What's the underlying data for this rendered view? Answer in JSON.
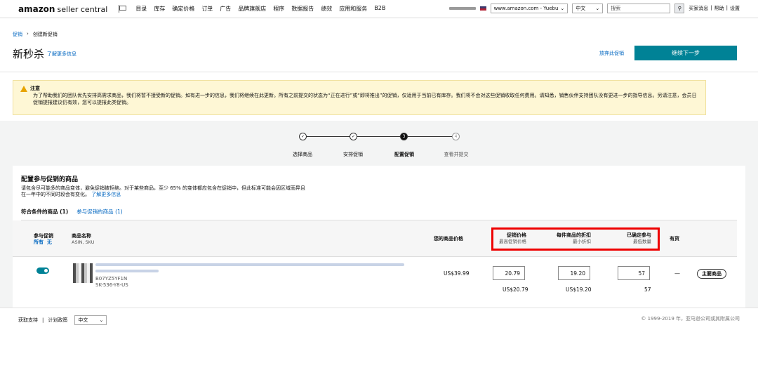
{
  "topbar": {
    "logo_brand": "amazon",
    "logo_product": "seller central",
    "nav": [
      "目录",
      "库存",
      "确定价格",
      "订单",
      "广告",
      "品牌旗舰店",
      "程序",
      "数据报告",
      "绩效",
      "应用和服务",
      "B2B"
    ],
    "marketplace": "www.amazon.com - Yuebu",
    "language": "中文",
    "search_placeholder": "搜索",
    "links": [
      "买家消息",
      "帮助",
      "设置"
    ]
  },
  "breadcrumb": {
    "root": "促销",
    "sep": "›",
    "current": "创建新促销"
  },
  "page": {
    "title": "新秒杀",
    "learn_more": "了解更多信息",
    "abandon": "放弃此促销",
    "continue": "继续下一步"
  },
  "notice": {
    "title": "注意",
    "body": "为了帮助我们的团队优先安排高需求商品，我们将暂不接受新的促销。如有进一步的信息，我们将继续在此更新。所有之前提交的状态为“正在进行”或“即将推出”的促销，仅适用于当前已有库存。我们将不会对这些促销收取任何费用。请知悉，销售伙伴支持团队没有更进一步的指导信息。另请注意，会员日促销提报建议仍有效，您可以提报此类促销。"
  },
  "steps": [
    {
      "num": "✓",
      "label": "选择商品"
    },
    {
      "num": "✓",
      "label": "安排促销"
    },
    {
      "num": "3",
      "label": "配置促销"
    },
    {
      "num": "4",
      "label": "查看并提交"
    }
  ],
  "section": {
    "title": "配置参与促销的商品",
    "desc": "请包含尽可能多的商品变体，避免促销被拒绝。对于某些商品，至少 65% 的变体都应包含在促销中，但此标准可能会因区域而异且在一年中的不同时段会有变化。",
    "desc_link": "了解更多信息",
    "tab_eligible": "符合条件的商品 (1)",
    "tab_participating": "参与促销的商品 (1)"
  },
  "table": {
    "col_participate": "参与促销",
    "col_all": "所有",
    "col_none": "无",
    "col_name": "商品名称",
    "col_name_sub": "ASIN, SKU",
    "col_your_price": "您的商品价格",
    "col_deal_price": "促销价格",
    "col_deal_price_sub": "最高促销价格",
    "col_discount": "每件商品的折扣",
    "col_discount_sub": "最小折扣",
    "col_committed": "已确定参与",
    "col_committed_sub": "最低数量",
    "col_stock": "有货"
  },
  "row": {
    "asin": "B07YZ5YF1N",
    "sku": "SK-536-Y8-US",
    "your_price": "US$39.99",
    "deal_price": "20.79",
    "deal_price_max": "US$20.79",
    "discount": "19.20",
    "discount_min": "US$19.20",
    "committed": "57",
    "committed_min": "57",
    "stock": "—",
    "badge": "主要商品"
  },
  "footer": {
    "support": "获取支持",
    "policy": "计划政策",
    "language": "中文",
    "copyright": "© 1999-2019 年，亚马逊公司或其附属公司"
  }
}
